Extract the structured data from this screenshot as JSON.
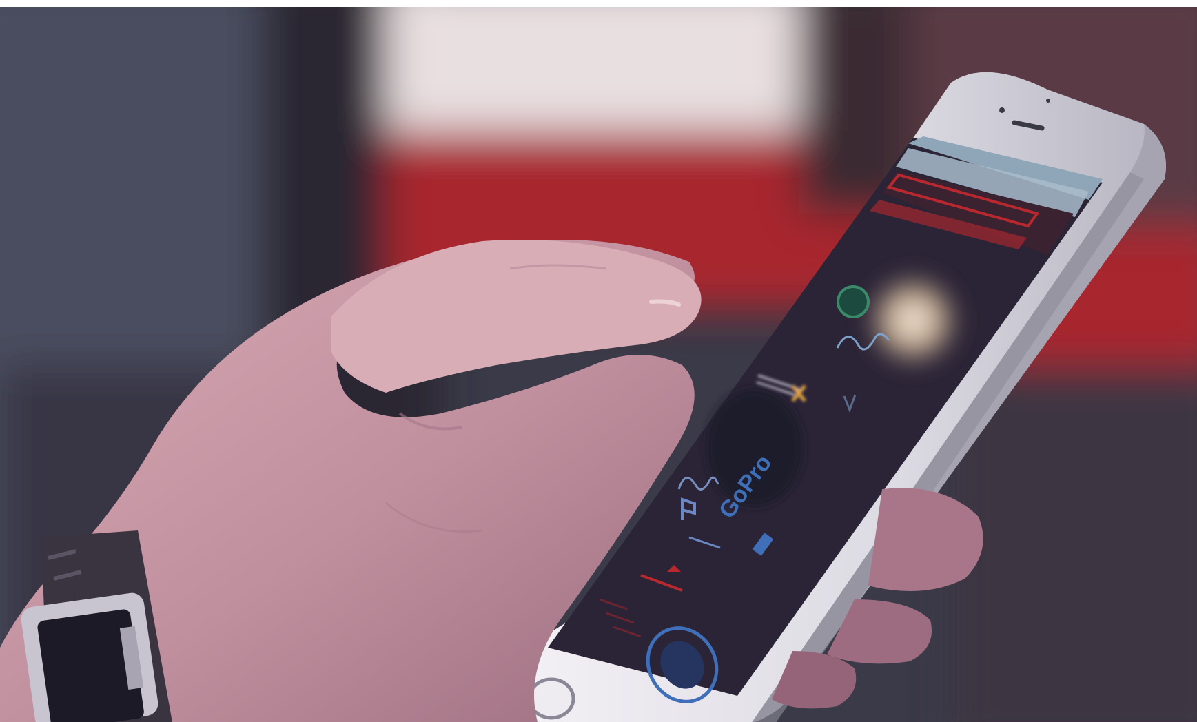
{
  "photo": {
    "subject": "hand-holding-smartphone",
    "screen_logos": [
      "GoPro"
    ],
    "colors": {
      "background_red": "#a8262e",
      "background_dark": "#2a2430",
      "skin": "#c99aa6",
      "phone_body": "#e6e4ea",
      "screen": "#2b2436",
      "logo_blue": "#3e6fb8",
      "logo_green": "#3a8a6a",
      "logo_orange": "#e2a23c",
      "accent_red": "#b8282e"
    }
  }
}
